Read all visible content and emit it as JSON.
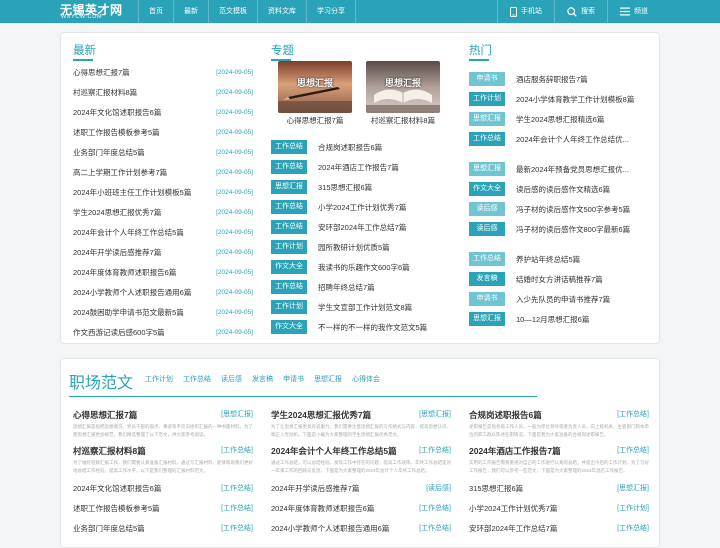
{
  "header": {
    "logo_main": "无锡英才网",
    "logo_sub": "WXYCW.COM",
    "nav": [
      "首页",
      "最新",
      "范文模板",
      "资料文库",
      "学习分享"
    ],
    "mobile_label": "手机站",
    "search_label": "搜索",
    "channel_label": "频道"
  },
  "latest": {
    "title": "最新",
    "items": [
      {
        "text": "心得思想汇报7篇",
        "date": "[2024-09-05]"
      },
      {
        "text": "村巡察汇报材料8篇",
        "date": "[2024-09-05]"
      },
      {
        "text": "2024年文化馆述职报告6篇",
        "date": "[2024-09-05]"
      },
      {
        "text": "述职工作报告模板参考5篇",
        "date": "[2024-09-05]"
      },
      {
        "text": "业务部门年度总结5篇",
        "date": "[2024-09-05]"
      },
      {
        "text": "高二上学期工作计划参考7篇",
        "date": "[2024-09-05]"
      },
      {
        "text": "2024年小班班主任工作计划模板5篇",
        "date": "[2024-09-05]"
      },
      {
        "text": "学生2024思想汇报优秀7篇",
        "date": "[2024-09-05]"
      },
      {
        "text": "2024年会计个人年终工作总结5篇",
        "date": "[2024-09-05]"
      },
      {
        "text": "2024年开学读后感推荐7篇",
        "date": "[2024-09-05]"
      },
      {
        "text": "2024年度体育教师述职报告6篇",
        "date": "[2024-09-05]"
      },
      {
        "text": "2024小学教师个人述职报告通用6篇",
        "date": "[2024-09-05]"
      },
      {
        "text": "2024鼓困助学申请书范文最新5篇",
        "date": "[2024-09-05]"
      },
      {
        "text": "作文西游记读后感600字5篇",
        "date": "[2024-09-05]"
      }
    ]
  },
  "topic": {
    "title": "专题",
    "thumbs": [
      {
        "overlay": "思想汇报",
        "caption": "心得思想汇报7篇"
      },
      {
        "overlay": "思想汇报",
        "caption": "村巡察汇报材料8篇"
      }
    ],
    "items": [
      {
        "tag": "工作总结",
        "text": "合规岗述职报告6篇"
      },
      {
        "tag": "工作总结",
        "text": "2024年酒店工作报告7篇"
      },
      {
        "tag": "思想汇报",
        "text": "315思想汇报6篇"
      },
      {
        "tag": "工作总结",
        "text": "小学2024工作计划优秀7篇"
      },
      {
        "tag": "工作总结",
        "text": "安环部2024年工作总结7篇"
      },
      {
        "tag": "工作计划",
        "text": "园所教研计划优质5篇"
      },
      {
        "tag": "作文大全",
        "text": "我读书的乐趣作文600字6篇"
      },
      {
        "tag": "工作总结",
        "text": "招聘年终总结7篇"
      },
      {
        "tag": "工作计划",
        "text": "学生文宣部工作计划范文8篇"
      },
      {
        "tag": "作文大全",
        "text": "不一样的不一样的我作文范文5篇"
      }
    ]
  },
  "hot": {
    "title": "热门",
    "groups": [
      [
        {
          "tag": "申请书",
          "text": "酒店服务辞职报告7篇"
        },
        {
          "tag": "工作计划",
          "text": "2024小学体育教学工作计划模板8篇"
        },
        {
          "tag": "思想汇报",
          "text": "学生2024思想汇报精选6篇"
        },
        {
          "tag": "工作总结",
          "text": "2024年会计个人年终工作总结优..."
        }
      ],
      [
        {
          "tag": "思想汇报",
          "text": "最新2024年预备党员思想汇报优..."
        },
        {
          "tag": "作文大全",
          "text": "读后感的读后感作文精选6篇"
        },
        {
          "tag": "读后感",
          "text": "冯子材的读后感作文500字参考5篇"
        },
        {
          "tag": "读后感",
          "text": "冯子材的读后感作文800字最新6篇"
        }
      ],
      [
        {
          "tag": "工作总结",
          "text": "养护站年终总结5篇"
        },
        {
          "tag": "发言稿",
          "text": "结婚时女方讲话稿推荐7篇"
        },
        {
          "tag": "申请书",
          "text": "入少先队员的申请书推荐7篇"
        },
        {
          "tag": "思想汇报",
          "text": "10—12月思想汇报6篇"
        }
      ]
    ]
  },
  "career": {
    "title": "职场范文",
    "nav": [
      "工作计划",
      "工作总结",
      "读后感",
      "发言稿",
      "申请书",
      "思想汇报",
      "心得体会"
    ],
    "columns": [
      {
        "featured": [
          {
            "title": "心得思想汇报7篇",
            "tag": "[思想汇报]",
            "desc": "思想汇报是指把思想情况、党员干部的观点、事迹等不仅向组织汇报的一种书面材料。为了使思想汇报更加规范，我们精选整理了以下范文，供大家参考阅读。"
          },
          {
            "title": "村巡察汇报材料8篇",
            "tag": "[工作总结]",
            "desc": "为了做好巡察汇报工作，我们需要认真准备汇报材料，通过写汇报材料，能够帮助我们更好地总结工作经验，提高工作水平，以下是我们整理的汇报材料范文。"
          }
        ],
        "list": [
          {
            "text": "2024年文化馆述职报告6篇",
            "tag": "[工作总结]"
          },
          {
            "text": "述职工作报告模板参考5篇",
            "tag": "[工作总结]"
          },
          {
            "text": "业务部门年度总结5篇",
            "tag": "[工作总结]"
          }
        ]
      },
      {
        "featured": [
          {
            "title": "学生2024思想汇报优秀7篇",
            "tag": "[思想汇报]",
            "desc": "为了让思想汇报更具有说服力，我们需要注意思想汇报的写作格式与内容，提高思想认识、端正入党动机，下面是小编为大家整理的学生思想汇报优秀范文。"
          },
          {
            "title": "2024年会计个人年终工作总结5篇",
            "tag": "[工作总结]",
            "desc": "通过工作总结，可以总结经验，发现工作中存在的问题，提高工作效率。年终工作总结是对一年来工作的回顾与反思，下面是为大家整理的2024年会计个人年终工作总结。"
          }
        ],
        "list": [
          {
            "text": "2024年开学读后感推荐7篇",
            "tag": "[读后感]"
          },
          {
            "text": "2024年度体育教师述职报告6篇",
            "tag": "[工作总结]"
          },
          {
            "text": "2024小学教师个人述职报告通用6篇",
            "tag": "[工作总结]"
          }
        ]
      },
      {
        "featured": [
          {
            "title": "合规岗述职报告6篇",
            "tag": "[工作总结]",
            "desc": "述职报告是指各级工作人员，一般为单位领导或者负责人员，向上级机关、主管部门和本单位的职工群众陈述任职情况，下面是我为大家准备的合规岗述职报告。"
          },
          {
            "title": "2024年酒店工作报告7篇",
            "tag": "[工作总结]",
            "desc": "实用的工作报告需要重视对自己的工作进行认真的总结，并提出今后的工作计划，为了写好工作报告，我们可以参考一些范文，下面是为大家整理的2024年酒店工作报告。"
          }
        ],
        "list": [
          {
            "text": "315思想汇报6篇",
            "tag": "[思想汇报]"
          },
          {
            "text": "小学2024工作计划优秀7篇",
            "tag": "[工作计划]"
          },
          {
            "text": "安环部2024年工作总结7篇",
            "tag": "[工作总结]"
          }
        ]
      }
    ]
  },
  "colors": {
    "accent": "#2aa3b8",
    "accent_light": "#6fc6d2"
  }
}
